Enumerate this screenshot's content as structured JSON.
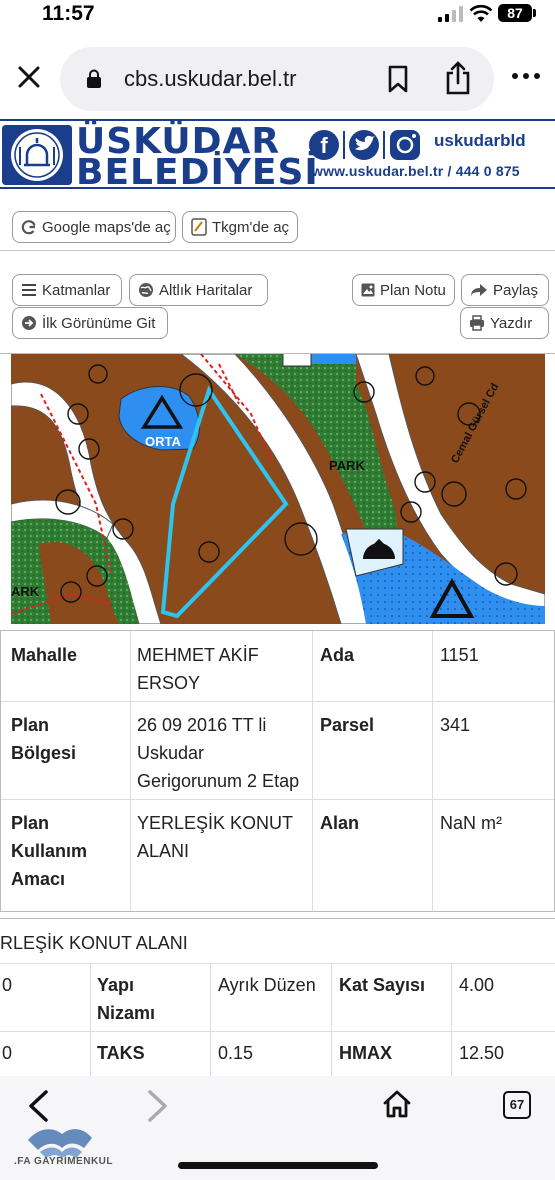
{
  "status_bar": {
    "time": "11:57",
    "battery": "87"
  },
  "browser": {
    "url": "cbs.uskudar.bel.tr",
    "tab_count": "67"
  },
  "banner": {
    "brand_line1": "ÜSKÜDAR",
    "brand_line2": "BELEDİYESİ",
    "social_handle": "uskudarbld",
    "web_contact": "www.uskudar.bel.tr / 444 0 875",
    "seal_text": "ÜSKÜDAR BELEDİYE BAŞKANLIĞI"
  },
  "toolbar": {
    "google_maps": "Google maps'de aç",
    "tkgm": "Tkgm'de aç",
    "layers": "Katmanlar",
    "base_maps": "Altlık Haritalar",
    "plan_note": "Plan Notu",
    "share": "Paylaş",
    "initial_view": "İlk Görünüme Git",
    "print": "Yazdır"
  },
  "map": {
    "labels": {
      "orta": "ORTA",
      "park_left": "ARK",
      "park_center": "PARK",
      "street": "Cemal Gürsel Cd"
    }
  },
  "parcel_info": {
    "mahalle_label": "Mahalle",
    "mahalle_value": "MEHMET AKİF ERSOY",
    "ada_label": "Ada",
    "ada_value": "1151",
    "plan_bolgesi_label": "Plan Bölgesi",
    "plan_bolgesi_value": "26 09 2016 TT li Uskudar Gerigorunum 2 Etap",
    "parsel_label": "Parsel",
    "parsel_value": "341",
    "kullanim_label": "Plan Kullanım Amacı",
    "kullanim_value": "YERLEŞİK KONUT ALANI",
    "alan_label": "Alan",
    "alan_value": "NaN m²"
  },
  "zone_info": {
    "title": "RLEŞİK KONUT ALANI",
    "row1_left": "0",
    "yapi_label": "Yapı Nizamı",
    "yapi_value": "Ayrık Düzen",
    "kat_label": "Kat Sayısı",
    "kat_value": "4.00",
    "row2_left": "0",
    "taks_label": "TAKS",
    "taks_value": "0.15",
    "hmax_label": "HMAX",
    "hmax_value": "12.50"
  },
  "watermark": {
    "text": ".FA GAYRİMENKUL"
  },
  "colors": {
    "brand": "#1a3e8c",
    "parcel": "#2ec4f0",
    "residential": "#8b4a1c",
    "park": "#2e7d32",
    "edu": "#2f8ff0"
  }
}
